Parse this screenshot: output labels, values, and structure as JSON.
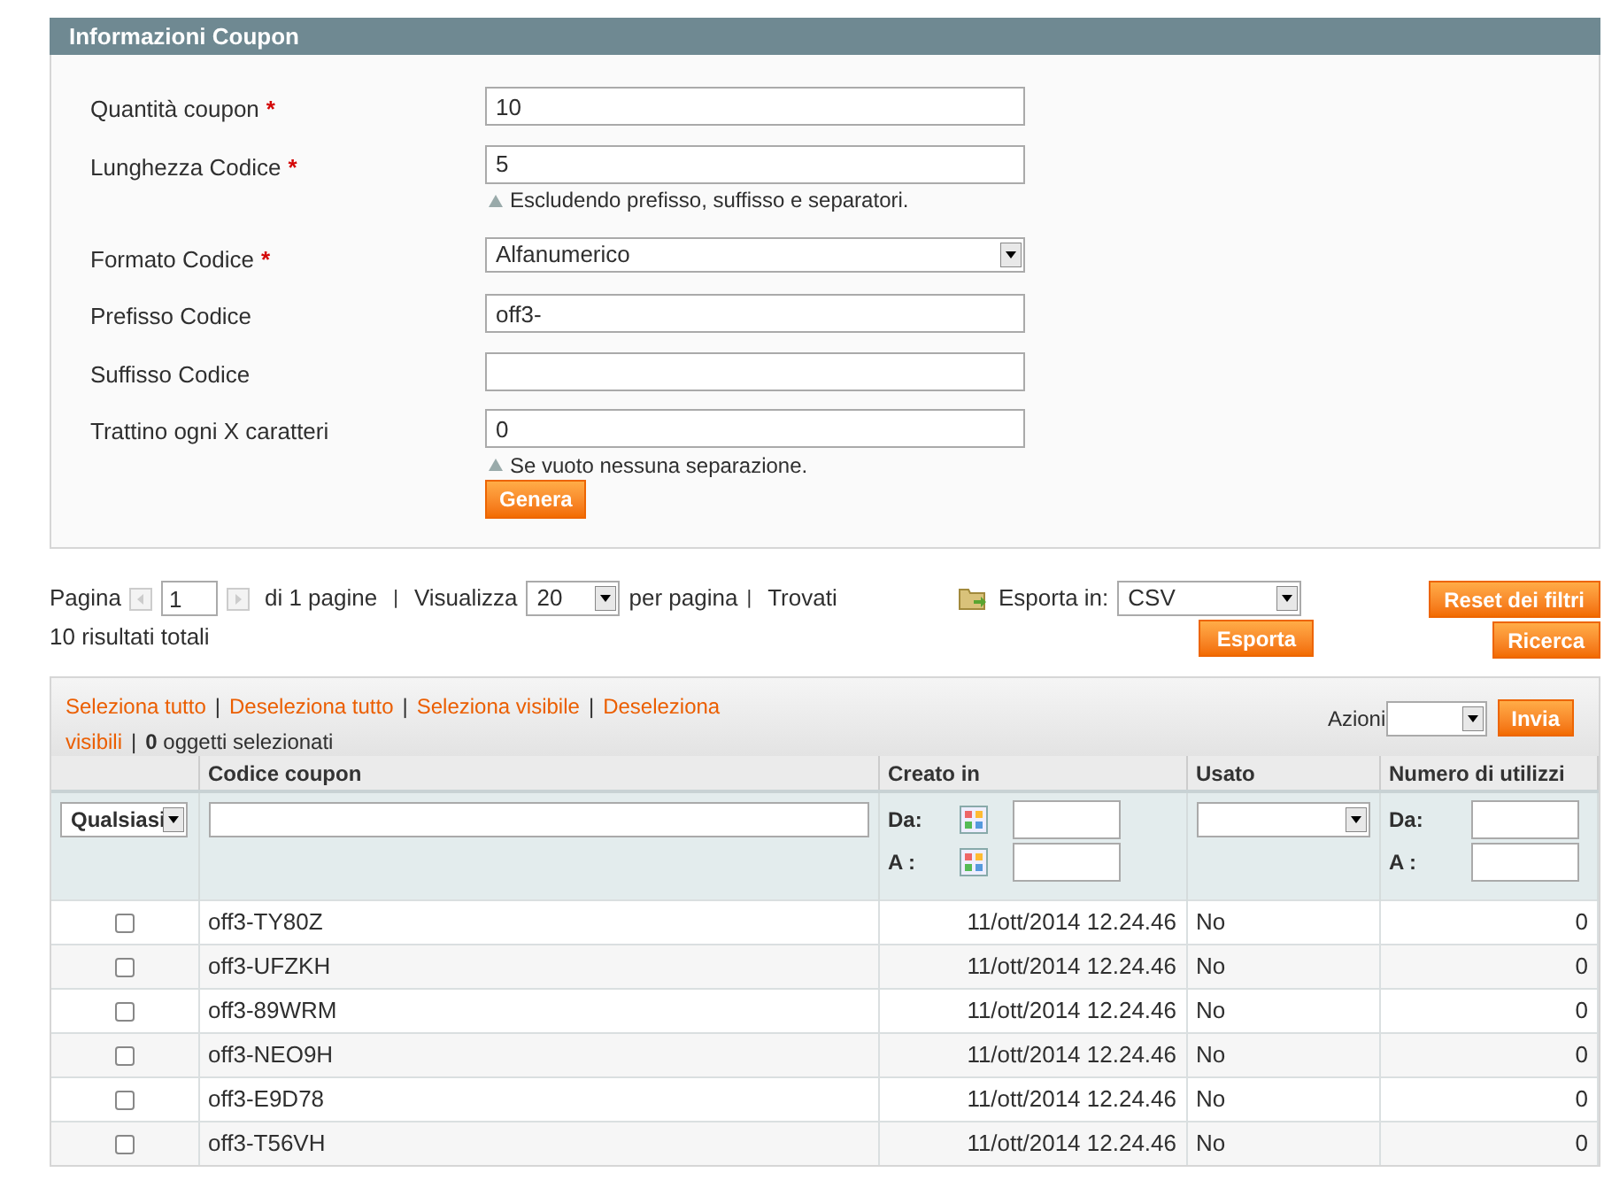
{
  "form": {
    "title": "Informazioni Coupon",
    "fields": [
      {
        "kind": "text",
        "label": "Quantità coupon",
        "required_mark": "*",
        "value": "10"
      },
      {
        "kind": "text",
        "label": "Lunghezza Codice",
        "required_mark": "*",
        "value": "5",
        "hint": "Escludendo prefisso, suffisso e separatori."
      },
      {
        "kind": "select",
        "label": "Formato Codice",
        "required_mark": "*",
        "value": "Alfanumerico"
      },
      {
        "kind": "text",
        "label": "Prefisso Codice",
        "value": "off3-"
      },
      {
        "kind": "text",
        "label": "Suffisso Codice"
      },
      {
        "kind": "text",
        "label": "Trattino ogni X caratteri",
        "value": "0",
        "hint": "Se vuoto nessuna separazione."
      }
    ],
    "button": "Genera"
  },
  "pager": {
    "separators": [
      "|",
      "|"
    ],
    "page_label": "Pagina",
    "page": "1",
    "of_pages": "di 1 pagine",
    "show_label": "Visualizza",
    "per_page": "20",
    "per_page_label": "per pagina",
    "found": "Trovati",
    "total": "10 risultati totali",
    "export_label": "Esporta in:",
    "export_format": "CSV",
    "export_button": "Esporta",
    "reset_button": "Reset dei filtri",
    "search_button": "Ricerca"
  },
  "massaction": {
    "links": [
      "Seleziona tutto",
      "Deseleziona tutto",
      "Seleziona visibile",
      "Deseleziona",
      "visibili"
    ],
    "separators": [
      "|",
      "|",
      "|",
      "|"
    ],
    "count": "0",
    "count_label": "oggetti selezionati",
    "actions_label": "Azioni",
    "submit": "Invia"
  },
  "table": {
    "columns": [
      "Codice coupon",
      "Creato in",
      "Usato",
      "Numero di utilizzi"
    ],
    "filter": {
      "select": "Qualsiasi",
      "created_from": "Da:",
      "created_to": "A :",
      "uses_from": "Da:",
      "uses_to": "A :"
    },
    "rows": [
      {
        "checked": false,
        "code": "off3-TY80Z",
        "created": "11/ott/2014 12.24.46",
        "used": "No",
        "uses": "0"
      },
      {
        "checked": false,
        "code": "off3-UFZKH",
        "created": "11/ott/2014 12.24.46",
        "used": "No",
        "uses": "0"
      },
      {
        "checked": false,
        "code": "off3-89WRM",
        "created": "11/ott/2014 12.24.46",
        "used": "No",
        "uses": "0"
      },
      {
        "checked": false,
        "code": "off3-NEO9H",
        "created": "11/ott/2014 12.24.46",
        "used": "No",
        "uses": "0"
      },
      {
        "checked": false,
        "code": "off3-E9D78",
        "created": "11/ott/2014 12.24.46",
        "used": "No",
        "uses": "0"
      },
      {
        "checked": false,
        "code": "off3-T56VH",
        "created": "11/ott/2014 12.24.46",
        "used": "No",
        "uses": "0"
      }
    ]
  }
}
